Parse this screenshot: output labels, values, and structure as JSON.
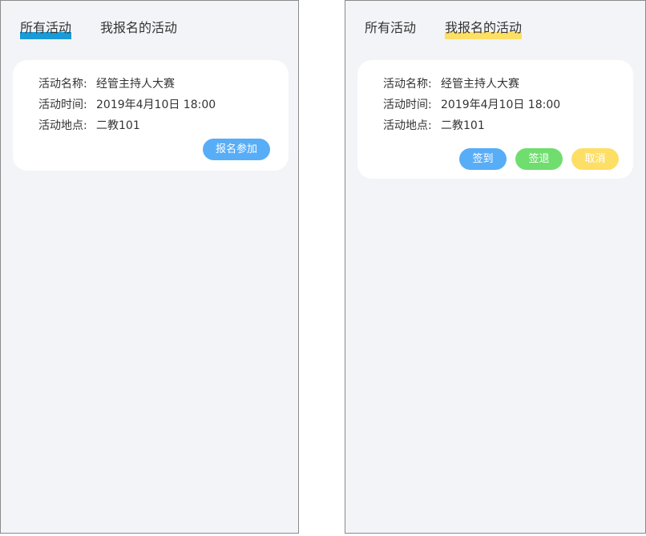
{
  "tabs": {
    "all": "所有活动",
    "mine": "我报名的活动"
  },
  "activity": {
    "name_label": "活动名称:",
    "name": "经管主持人大赛",
    "time_label": "活动时间:",
    "time": "2019年4月10日 18:00",
    "place_label": "活动地点:",
    "place": "二教101"
  },
  "buttons": {
    "join": "报名参加",
    "sign_in": "签到",
    "sign_out": "签退",
    "cancel": "取消"
  },
  "colors": {
    "all_tab_underline": "#1a9ad6",
    "mine_tab_underline": "#fddf66",
    "join": "#58adf7",
    "sign_in": "#58adf7",
    "sign_out": "#6fde6f",
    "cancel": "#fddf66"
  }
}
